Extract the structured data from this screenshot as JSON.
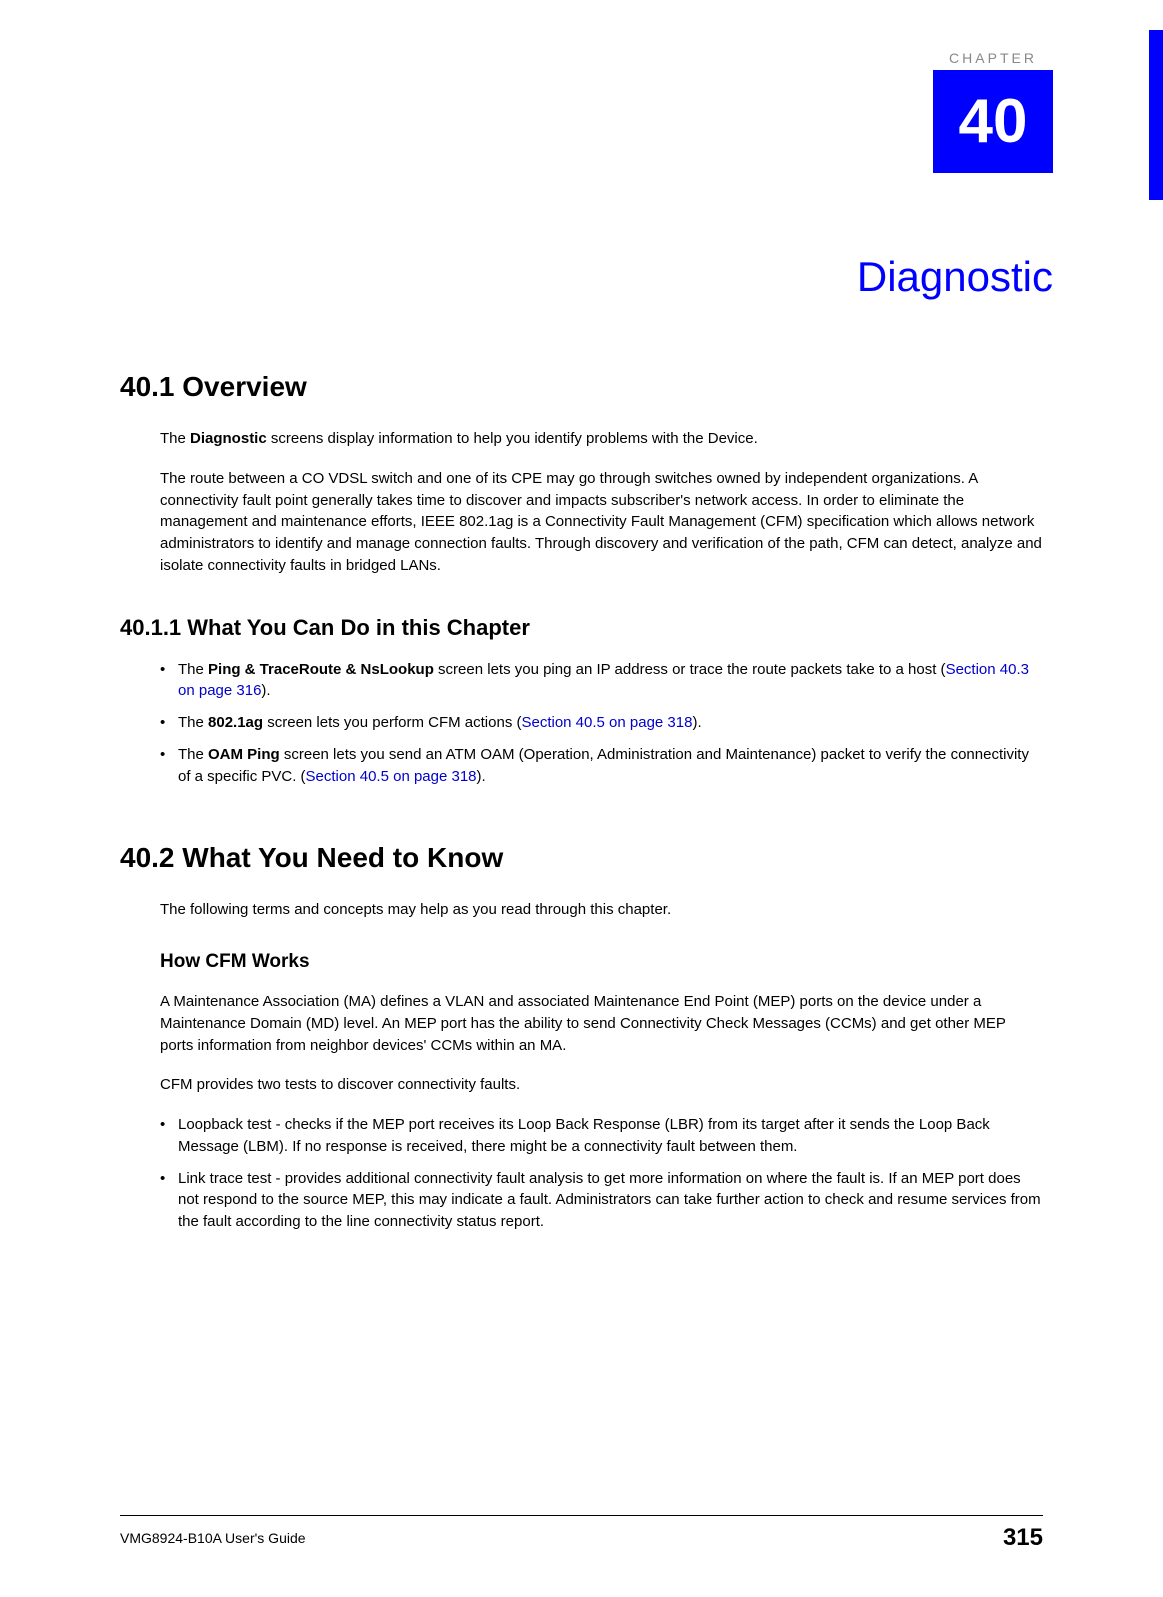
{
  "chapter": {
    "label": "CHAPTER",
    "number": "40",
    "title": "Diagnostic"
  },
  "sections": {
    "overview": {
      "heading": "40.1  Overview",
      "para1_pre": "The ",
      "para1_bold": "Diagnostic",
      "para1_post": " screens display information to help you identify identify problems with the Device.",
      "para1_full_pre": "The ",
      "para1_full_post": " screens display information to help you identify problems with the Device.",
      "para2": "The route between a CO VDSL switch and one of its CPE may go through switches owned by independent organizations. A connectivity fault point generally takes time to discover and impacts subscriber's network access. In order to eliminate the management and maintenance efforts, IEEE 802.1ag is a Connectivity Fault Management (CFM) specification which allows network administrators to identify and manage connection faults. Through discovery and verification of the path, CFM can detect, analyze and isolate connectivity faults in bridged LANs."
    },
    "what_can_do": {
      "heading": "40.1.1  What You Can Do in this Chapter",
      "items": [
        {
          "pre": "The ",
          "bold": "Ping & TraceRoute & NsLookup",
          "mid": " screen lets you ping an IP address or trace the route packets take to a host (",
          "link": "Section 40.3 on page 316",
          "post": ")."
        },
        {
          "pre": "The ",
          "bold": "802.1ag",
          "mid": " screen lets you perform CFM actions (",
          "link": "Section 40.5 on page 318",
          "post": ")."
        },
        {
          "pre": "The ",
          "bold": "OAM Ping",
          "mid": " screen lets you send an ATM OAM (Operation, Administration and Maintenance) packet to verify the connectivity of a specific PVC. (",
          "link": "Section 40.5 on page 318",
          "post": ")."
        }
      ]
    },
    "need_to_know": {
      "heading": "40.2  What You Need to Know",
      "intro": "The following terms and concepts may help as you read through this chapter.",
      "cfm_heading": "How CFM Works",
      "cfm_para1": "A Maintenance Association (MA) defines a VLAN and associated Maintenance End Point (MEP) ports on the device under a Maintenance Domain (MD) level. An MEP port has the ability to send Connectivity Check Messages (CCMs) and get other MEP ports information from neighbor devices' CCMs within an MA.",
      "cfm_para2": "CFM provides two tests to discover connectivity faults.",
      "tests": [
        "Loopback test - checks if the MEP port receives its Loop Back Response (LBR) from its target after it sends the Loop Back Message (LBM). If no response is received, there might be a connectivity fault between them.",
        "Link trace test - provides additional connectivity fault analysis to get more information on where the fault is. If an MEP port does not respond to the source MEP, this may indicate a fault. Administrators can take further action to check and resume services from the fault according to the line connectivity status report."
      ]
    }
  },
  "footer": {
    "left": "VMG8924-B10A User's Guide",
    "right": "315"
  }
}
